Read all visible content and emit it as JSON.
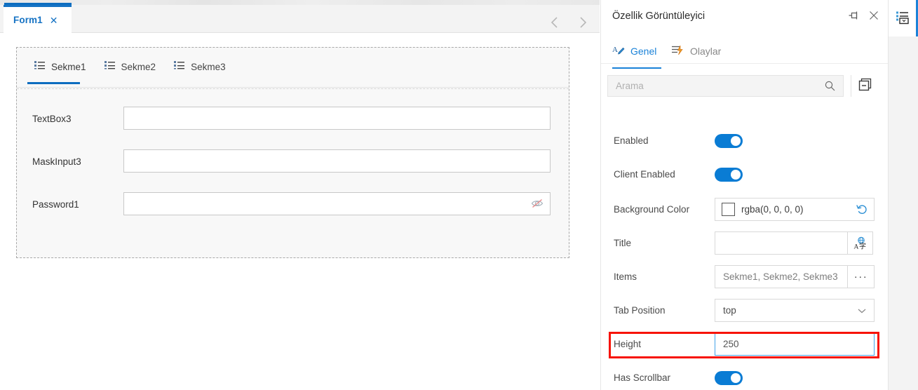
{
  "designer": {
    "document_tab": {
      "label": "Form1",
      "close_icon": "close-icon"
    },
    "nav": {
      "prev_icon": "chevron-left-icon",
      "next_icon": "chevron-right-icon"
    },
    "tabcontrol": {
      "tabs": [
        {
          "label": "Sekme1",
          "icon": "list-icon",
          "active": true
        },
        {
          "label": "Sekme2",
          "icon": "list-icon",
          "active": false
        },
        {
          "label": "Sekme3",
          "icon": "list-icon",
          "active": false
        }
      ],
      "fields": [
        {
          "label": "TextBox3",
          "value": "",
          "kind": "text"
        },
        {
          "label": "MaskInput3",
          "value": "",
          "kind": "mask"
        },
        {
          "label": "Password1",
          "value": "",
          "kind": "password",
          "icon": "eye-slash-icon"
        }
      ]
    }
  },
  "panel": {
    "title": "Özellik Görüntüleyici",
    "pin_icon": "pin-icon",
    "close_icon": "close-icon",
    "tabs": [
      {
        "label": "Genel",
        "icon": "edit-text-icon",
        "active": true
      },
      {
        "label": "Olaylar",
        "icon": "event-lightning-icon",
        "active": false
      }
    ],
    "search": {
      "placeholder": "Arama",
      "value": "",
      "icon": "search-icon"
    },
    "group_button_icon": "collapse-all-icon",
    "properties": [
      {
        "name": "Enabled",
        "type": "toggle",
        "value": "on"
      },
      {
        "name": "Client Enabled",
        "type": "toggle",
        "value": "on"
      },
      {
        "name": "Background Color",
        "type": "color",
        "value": "rgba(0, 0, 0, 0)",
        "swatch": "#ffffff",
        "reset_icon": "undo-icon"
      },
      {
        "name": "Title",
        "type": "text-with-button",
        "value": "",
        "button_icon": "translate-icon"
      },
      {
        "name": "Items",
        "type": "text-with-button",
        "value": "Sekme1, Sekme2, Sekme3",
        "button_label": "···"
      },
      {
        "name": "Tab Position",
        "type": "combo",
        "value": "top",
        "chevron": "chevron-down-icon"
      },
      {
        "name": "Height",
        "type": "number-focused",
        "value": "250",
        "highlighted": true
      },
      {
        "name": "Has Scrollbar",
        "type": "toggle",
        "value": "on"
      }
    ]
  },
  "right_rail": {
    "toolbox_icon": "toolbox-list-icon"
  },
  "colors": {
    "accent_blue": "#0d6dbf",
    "tab_blue": "#1673c4",
    "toggle_blue": "#0a7cd4",
    "focus_blue": "#44a3e8",
    "annotation_red": "#f71304",
    "panel_tab_blue": "#1a82d8"
  }
}
